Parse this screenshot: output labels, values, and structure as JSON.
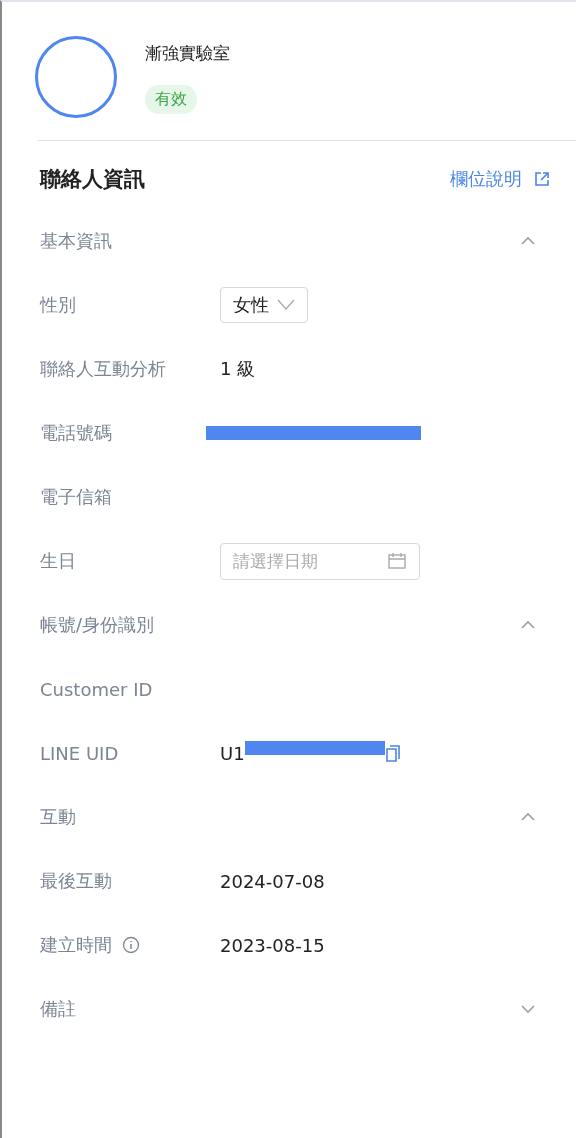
{
  "profile": {
    "name": "漸強實驗室",
    "status": "有效"
  },
  "header": {
    "title": "聯絡人資訊",
    "link": "欄位說明"
  },
  "sections": [
    {
      "title": "基本資訊",
      "expanded": true,
      "rows": [
        {
          "label": "性別",
          "kind": "select",
          "value": "女性"
        },
        {
          "label": "聯絡人互動分析",
          "kind": "text",
          "value": "1 級"
        },
        {
          "label": "電話號碼",
          "kind": "redacted"
        },
        {
          "label": "電子信箱",
          "kind": "empty"
        },
        {
          "label": "生日",
          "kind": "date",
          "placeholder": "請選擇日期"
        }
      ]
    },
    {
      "title": "帳號/身份識別",
      "expanded": true,
      "rows": [
        {
          "label": "Customer ID",
          "kind": "empty"
        },
        {
          "label": "LINE UID",
          "kind": "copy",
          "value": "U1"
        }
      ]
    },
    {
      "title": "互動",
      "expanded": true,
      "rows": [
        {
          "label": "最後互動",
          "kind": "text",
          "value": "2024-07-08"
        },
        {
          "label": "建立時間",
          "kind": "text",
          "info": true,
          "value": "2023-08-15"
        }
      ]
    },
    {
      "title": "備註",
      "expanded": false
    }
  ]
}
